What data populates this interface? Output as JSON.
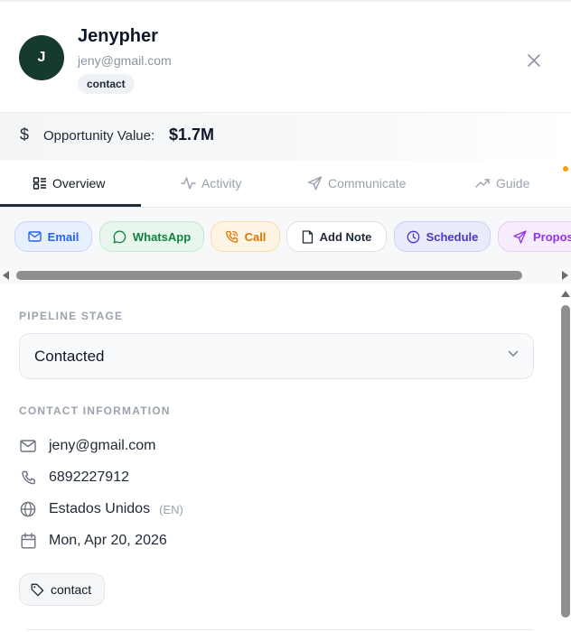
{
  "contact": {
    "avatar_initial": "J",
    "name": "Jenypher",
    "email": "jeny@gmail.com",
    "badge": "contact"
  },
  "opportunity": {
    "label": "Opportunity Value:",
    "value": "$1.7M"
  },
  "tabs": [
    {
      "label": "Overview",
      "icon": "overview-icon",
      "active": true
    },
    {
      "label": "Activity",
      "icon": "activity-icon",
      "active": false
    },
    {
      "label": "Communicate",
      "icon": "send-icon",
      "active": false
    },
    {
      "label": "Guide",
      "icon": "trending-icon",
      "active": false
    }
  ],
  "actions": [
    {
      "label": "Email",
      "icon": "mail-icon",
      "color": "#2563eb"
    },
    {
      "label": "WhatsApp",
      "icon": "whatsapp-icon",
      "color": "#15803d"
    },
    {
      "label": "Call",
      "icon": "phone-icon",
      "color": "#d97706"
    },
    {
      "label": "Add Note",
      "icon": "note-icon",
      "color": "#1f2937"
    },
    {
      "label": "Schedule",
      "icon": "clock-icon",
      "color": "#4338ca"
    },
    {
      "label": "Proposal",
      "icon": "send-icon",
      "color": "#9333ea"
    }
  ],
  "pipeline": {
    "title": "PIPELINE STAGE",
    "value": "Contacted"
  },
  "contact_info": {
    "title": "CONTACT INFORMATION",
    "email": "jeny@gmail.com",
    "phone": "6892227912",
    "country": "Estados Unidos",
    "language": "(EN)",
    "date": "Mon, Apr 20, 2026"
  },
  "tag": "contact"
}
